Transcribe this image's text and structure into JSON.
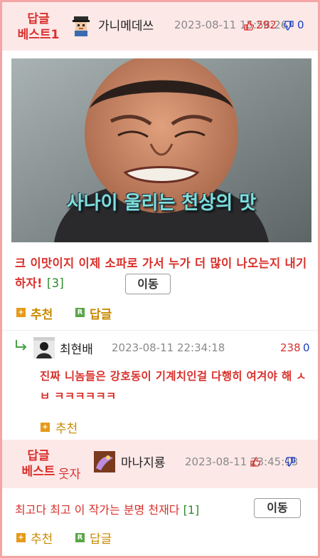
{
  "post1": {
    "badge_line1": "답글",
    "badge_line2": "베스트1",
    "nickname": "가니메데쓰",
    "date": "2023-08-11 15:58:26",
    "upvotes": "292",
    "downvotes": "0",
    "image_caption": "사나이 울리는 천상의 맛",
    "title": "크 이맛이지 이제 소파로 가서 누가 더 많이 나오는지 내기하자!",
    "comment_count": "[3]",
    "move_button": "이동",
    "recommend": "추천",
    "reply": "답글"
  },
  "comment1": {
    "nickname": "최현배",
    "date": "2023-08-11 22:34:18",
    "upvotes": "238",
    "downvotes": "0",
    "text": "진짜 니놈들은 강호동이 기계치인걸 다행히 여겨야 해 ㅅㅂ ㅋㅋㅋㅋㅋㅋ",
    "recommend": "추천"
  },
  "post2": {
    "badge_line1": "답글",
    "badge_line2": "베스트",
    "badge_suffix": "웃자",
    "nickname": "마나지룡",
    "date": "2023-08-11 23:45:13",
    "upvotes": "",
    "downvotes": "",
    "title": "최고다 최고 이 작가는 분명 천재다",
    "comment_count": "[1]",
    "move_button": "이동",
    "recommend": "추천",
    "reply": "답글"
  },
  "colors": {
    "accent_red": "#d9302b",
    "header_bg": "#fde8e8",
    "border": "#f4a5a5",
    "count_green": "#2e8b2e",
    "down_blue": "#1a3dbf"
  }
}
